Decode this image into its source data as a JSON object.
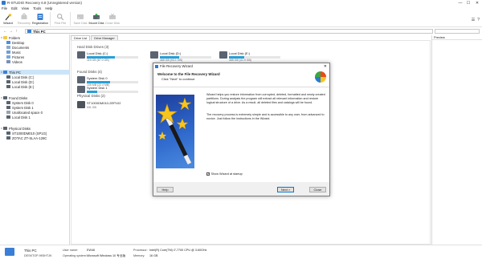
{
  "window": {
    "title": "R-STUDIO Recovery 6.8 (Unregistered version)",
    "minimize": "—",
    "maximize": "☐",
    "close": "✕"
  },
  "menu": [
    "File",
    "Edit",
    "View",
    "Tools",
    "Help"
  ],
  "toolbar": {
    "wizard": "Wizard",
    "recovery": "Recovery",
    "registration": "Registration",
    "find_file": "Find File",
    "save_disk": "Save Disk",
    "mount_disk": "Mount Disk",
    "close_disk": "Close Disk"
  },
  "address": {
    "path": "This PC"
  },
  "sidebar": {
    "groups": [
      {
        "label": "Folders",
        "items": [
          "Desktop",
          "Documents",
          "Music",
          "Pictures",
          "Videos"
        ]
      },
      {
        "label": "This PC",
        "items": [
          "Local Disk (C:)",
          "Local Disk (D:)",
          "Local Disk (E:)"
        ]
      },
      {
        "label": "Found Disks",
        "items": [
          "System Disk 0",
          "System Disk 1",
          "Unallocated space 0",
          "Local Disk 1"
        ]
      },
      {
        "label": "Physical Disks",
        "items": [
          "ST1000DM010 (SP1G)",
          "ZOTAC ZT-SLAA-128C"
        ]
      }
    ]
  },
  "tabs": [
    "Drive List",
    "Drive Manager"
  ],
  "main": {
    "hard_disk_title": "Hard Disk Drives (3)",
    "hard_disks": [
      {
        "name": "Local Disk (C:)",
        "size": "115 GB (87.0 GB)",
        "fill": 0.55
      },
      {
        "name": "Local Disk (D:)",
        "size": "465 GB (93.1 GB)",
        "fill": 0.38
      },
      {
        "name": "Local Disk (E:)",
        "size": "465 GB (41.9 GB)",
        "fill": 0.3
      }
    ],
    "found_title": "Found Disks (4)",
    "found_disks": [
      {
        "name": "System Disk 0",
        "size": "105 MB (22.4 MB)",
        "fill": 0.45
      },
      {
        "name": "System Disk 1",
        "size": "",
        "fill": 0.2
      }
    ],
    "physical_title": "Physical Disks (2)",
    "physical_disks": [
      {
        "name": "ST1000DM010-2EP102",
        "size": "931 GB"
      }
    ]
  },
  "preview": {
    "title": "Preview"
  },
  "status": {
    "pc_name": "This PC",
    "pc_sub": "DESKTOP-9K5HTJK",
    "user_label": "User name:",
    "user_value": "EW46",
    "os_label": "Operating system:",
    "os_value": "Microsoft Windows 10 专业版",
    "cpu_label": "Processor:",
    "cpu_value": "Intel(R) Core(TM) i7-7700 CPU @ 3.60GHz",
    "ram_label": "Memory:",
    "ram_value": "16 GB"
  },
  "wizard": {
    "title": "File Recovery Wizard",
    "close": "✕",
    "heading": "Welcome to the File Recovery Wizard",
    "subheading": "Click \"Next\" to continue",
    "para1": "Wizard helps you restore information from corrupted, deleted, formatted and newly created partitions. During analysis the program will extract all relevant information and restore logical structure of a drive. As a result, all deleted files and catalogs will be found.",
    "para2": "The recovery process is extremely simple and is accessible to any user, from advanced to novice. Just follow the instructions in the Wizard.",
    "checkbox_label": "Show Wizard at startup",
    "checkbox_mark": "✓",
    "help_button": "Help",
    "next_button": "Next >",
    "close_button": "Close"
  },
  "colors": {
    "accent": "#26a0da",
    "selection": "#cce4f7",
    "wizard_pic": "#2f69cc"
  }
}
